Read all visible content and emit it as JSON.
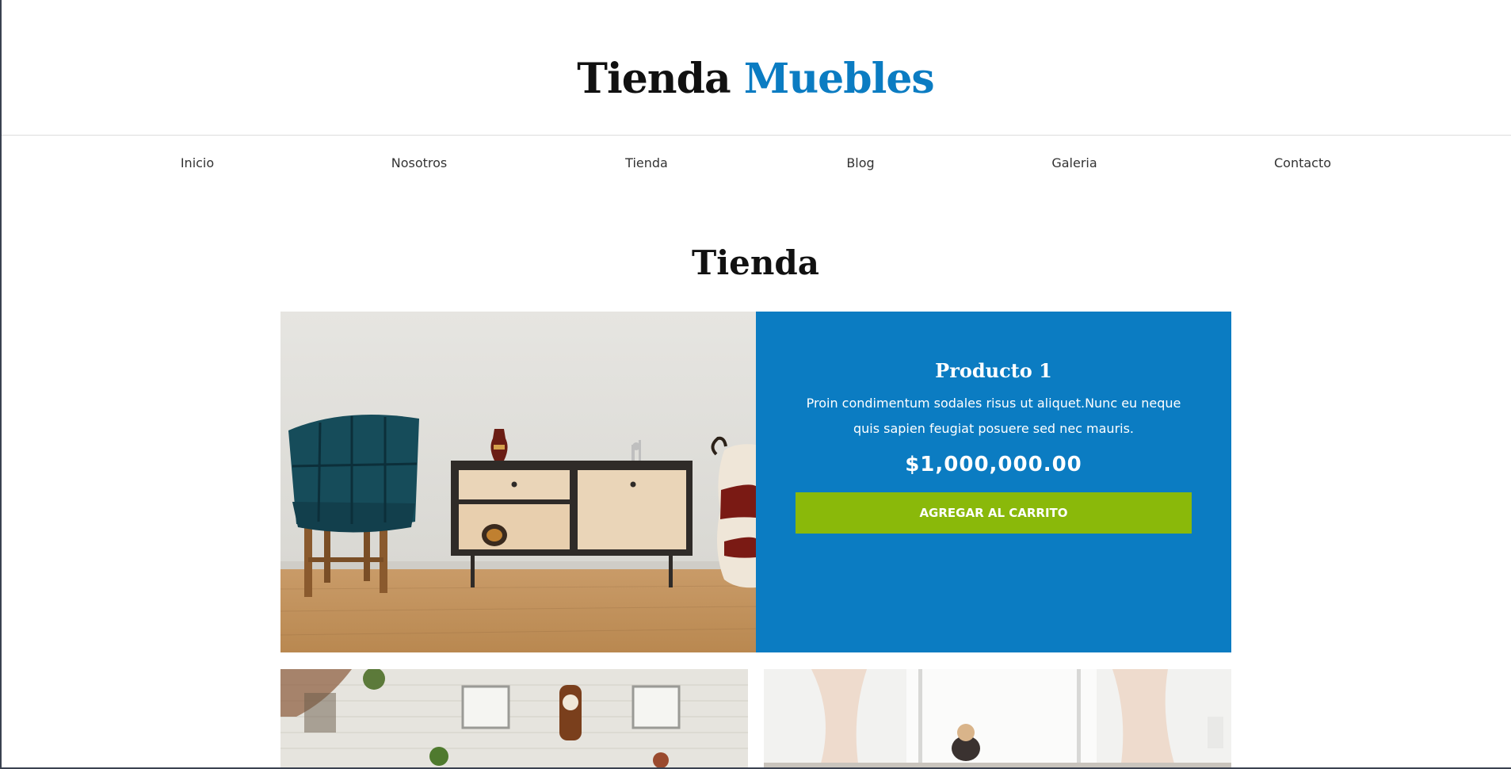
{
  "header": {
    "title_main": "Tienda",
    "title_accent": "Muebles"
  },
  "nav": {
    "items": [
      "Inicio",
      "Nosotros",
      "Tienda",
      "Blog",
      "Galeria",
      "Contacto"
    ]
  },
  "main": {
    "section_title": "Tienda",
    "featured_product": {
      "name": "Producto 1",
      "description": "Proin condimentum sodales risus ut aliquet.Nunc eu neque quis sapien feugiat posuere sed nec mauris.",
      "price": "$1,000,000.00",
      "button_label": "AGREGAR AL CARRITO"
    }
  },
  "colors": {
    "accent_blue": "#0b7cc2",
    "button_green": "#8ab90a",
    "header_rule": "#dcdcdc"
  }
}
